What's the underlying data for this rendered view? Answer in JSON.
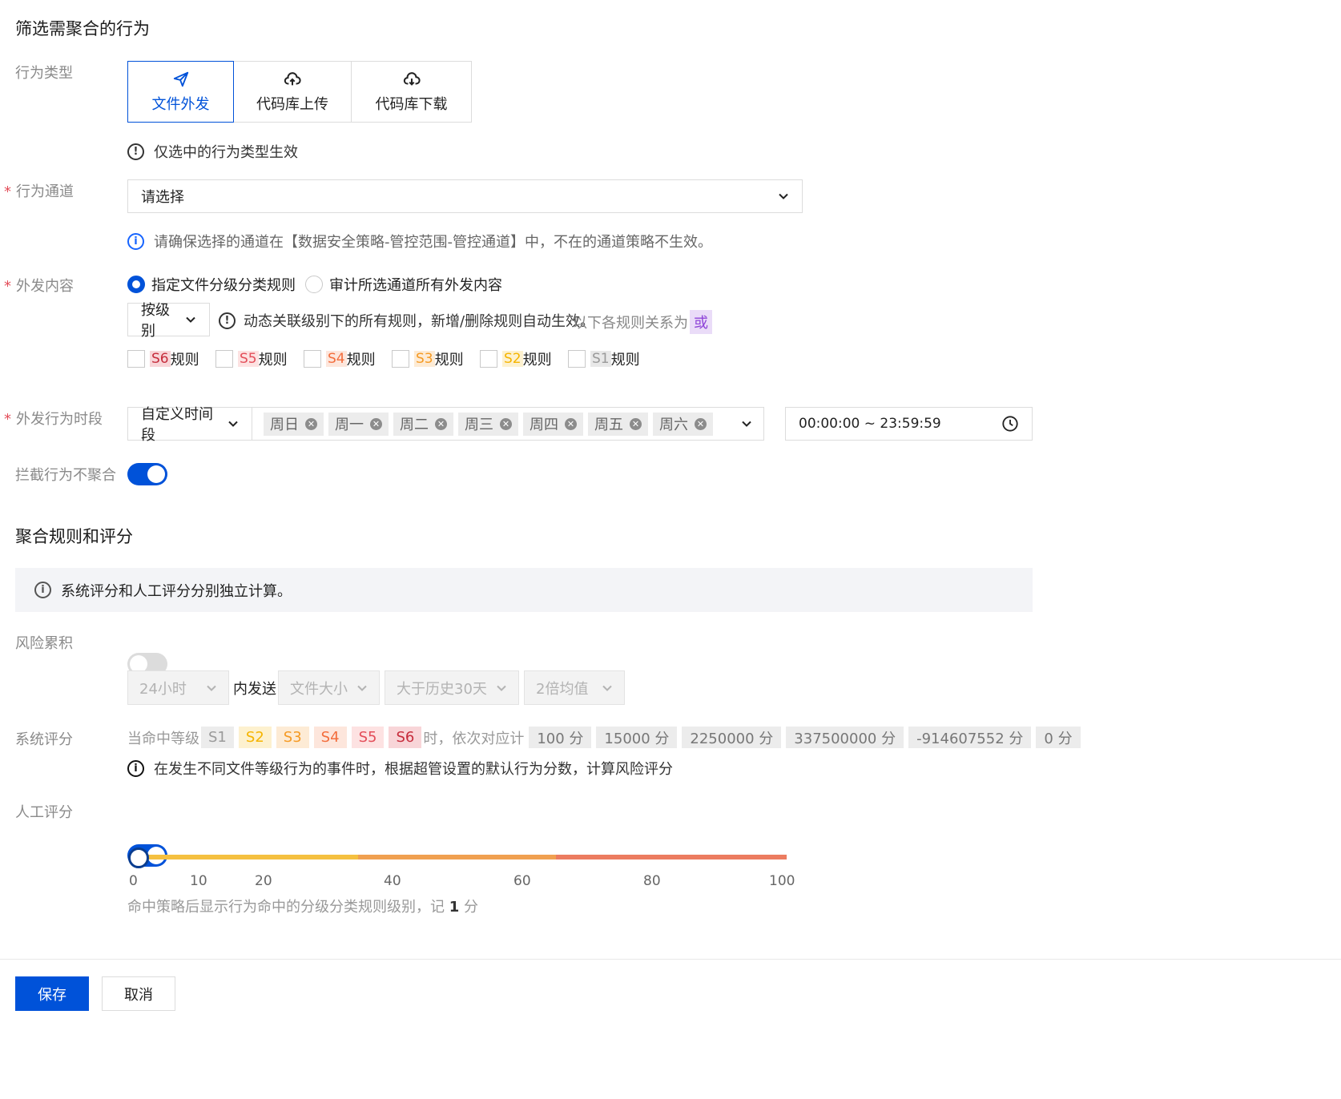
{
  "filter_section": {
    "title": "筛选需聚合的行为",
    "behavior_type": {
      "label": "行为类型",
      "options": [
        {
          "label": "文件外发",
          "icon": "paper-plane-icon",
          "active": true
        },
        {
          "label": "代码库上传",
          "icon": "cloud-upload-icon",
          "active": false
        },
        {
          "label": "代码库下载",
          "icon": "cloud-download-icon",
          "active": false
        }
      ],
      "tip": "仅选中的行为类型生效"
    },
    "channel": {
      "required": "*",
      "label": "行为通道",
      "placeholder": "请选择",
      "tip": "请确保选择的通道在【数据安全策略-管控范围-管控通道】中，不在的通道策略不生效。"
    },
    "content": {
      "required": "*",
      "label": "外发内容",
      "radio_1": "指定文件分级分类规则",
      "radio_2": "审计所选通道所有外发内容",
      "by_level": "按级别",
      "tip_main": "动态关联级别下的所有规则，新增/删除规则自动生效。",
      "tip_suffix": "以下各规则关系为",
      "tip_or": "或",
      "rules": [
        {
          "level": "S6",
          "suffix": "规则",
          "color": "#c62c3c",
          "bg": "#f8d5d8"
        },
        {
          "level": "S5",
          "suffix": "规则",
          "color": "#e34d59",
          "bg": "#fde2e2"
        },
        {
          "level": "S4",
          "suffix": "规则",
          "color": "#f36d3c",
          "bg": "#fde6dc"
        },
        {
          "level": "S3",
          "suffix": "规则",
          "color": "#f59a23",
          "bg": "#fdebd5"
        },
        {
          "level": "S2",
          "suffix": "规则",
          "color": "#f5b400",
          "bg": "#fdf1cf"
        },
        {
          "level": "S1",
          "suffix": "规则",
          "color": "#9a9a9a",
          "bg": "#e8e8e8"
        }
      ]
    },
    "period": {
      "required": "*",
      "label": "外发行为时段",
      "mode": "自定义时间段",
      "days": [
        "周日",
        "周一",
        "周二",
        "周三",
        "周四",
        "周五",
        "周六"
      ],
      "time_range": "00:00:00 ~ 23:59:59"
    },
    "no_aggregate_block": {
      "label": "拦截行为不聚合",
      "on": true
    }
  },
  "score_section": {
    "title": "聚合规则和评分",
    "banner": "系统评分和人工评分分别独立计算。",
    "risk_accum": {
      "label": "风险累积",
      "on": false,
      "window": "24小时",
      "mid_text": "内发送",
      "metric": "文件大小",
      "compare": "大于历史30天",
      "factor": "2倍均值"
    },
    "system_score": {
      "label": "系统评分",
      "prefix": "当命中等级",
      "levels": [
        {
          "text": "S1",
          "color": "#9a9a9a",
          "bg": "#ececec"
        },
        {
          "text": "S2",
          "color": "#f5b400",
          "bg": "#fdf1cf"
        },
        {
          "text": "S3",
          "color": "#f59a23",
          "bg": "#fdebd5"
        },
        {
          "text": "S4",
          "color": "#f36d3c",
          "bg": "#fde6dc"
        },
        {
          "text": "S5",
          "color": "#e34d59",
          "bg": "#fde2e2"
        },
        {
          "text": "S6",
          "color": "#c62c3c",
          "bg": "#f8d5d8"
        }
      ],
      "middle": "时，依次对应计",
      "scores": [
        "100 分",
        "15000 分",
        "2250000 分",
        "337500000 分",
        "-914607552 分",
        "0 分"
      ],
      "tip": "在发生不同文件等级行为的事件时，根据超管设置的默认行为分数，计算风险评分"
    },
    "manual_score": {
      "label": "人工评分",
      "on": true,
      "slider_value": 1,
      "ticks": [
        "0",
        "10",
        "20",
        "40",
        "60",
        "80",
        "100"
      ],
      "note_prefix": "命中策略后显示行为命中的分级分类规则级别，记",
      "note_value": "1",
      "note_suffix": "分"
    }
  },
  "footer": {
    "save": "保存",
    "cancel": "取消"
  },
  "colors": {
    "primary": "#0052d9",
    "slider_yellow": "#f5c040",
    "slider_orange": "#f0a050",
    "slider_red": "#ec7c60"
  }
}
